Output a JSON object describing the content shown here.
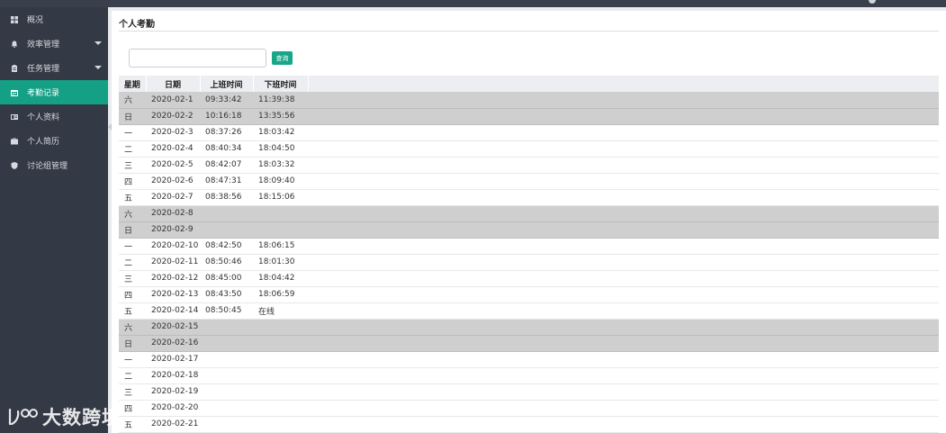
{
  "sidebar": {
    "items": [
      {
        "label": "概况",
        "icon": "dashboard-icon",
        "active": false,
        "has_caret": false
      },
      {
        "label": "效率管理",
        "icon": "bell-icon",
        "active": false,
        "has_caret": true
      },
      {
        "label": "任务管理",
        "icon": "clipboard-icon",
        "active": false,
        "has_caret": true
      },
      {
        "label": "考勤记录",
        "icon": "calendar-icon",
        "active": true,
        "has_caret": false
      },
      {
        "label": "个人资料",
        "icon": "id-card-icon",
        "active": false,
        "has_caret": false
      },
      {
        "label": "个人简历",
        "icon": "briefcase-icon",
        "active": false,
        "has_caret": false
      },
      {
        "label": "讨论组管理",
        "icon": "shield-icon",
        "active": false,
        "has_caret": false
      }
    ]
  },
  "watermark": {
    "text": "大数跨境"
  },
  "panel": {
    "title": "个人考勤"
  },
  "search": {
    "value": "",
    "placeholder": "",
    "button_label": "查询"
  },
  "table": {
    "headers": [
      "星期",
      "日期",
      "上班时间",
      "下班时间"
    ],
    "rows": [
      {
        "day": "六",
        "date": "2020-02-1",
        "in": "09:33:42",
        "out": "11:39:38",
        "weekend": true
      },
      {
        "day": "日",
        "date": "2020-02-2",
        "in": "10:16:18",
        "out": "13:35:56",
        "weekend": true
      },
      {
        "day": "一",
        "date": "2020-02-3",
        "in": "08:37:26",
        "out": "18:03:42",
        "weekend": false
      },
      {
        "day": "二",
        "date": "2020-02-4",
        "in": "08:40:34",
        "out": "18:04:50",
        "weekend": false
      },
      {
        "day": "三",
        "date": "2020-02-5",
        "in": "08:42:07",
        "out": "18:03:32",
        "weekend": false
      },
      {
        "day": "四",
        "date": "2020-02-6",
        "in": "08:47:31",
        "out": "18:09:40",
        "weekend": false
      },
      {
        "day": "五",
        "date": "2020-02-7",
        "in": "08:38:56",
        "out": "18:15:06",
        "weekend": false
      },
      {
        "day": "六",
        "date": "2020-02-8",
        "in": "",
        "out": "",
        "weekend": true
      },
      {
        "day": "日",
        "date": "2020-02-9",
        "in": "",
        "out": "",
        "weekend": true
      },
      {
        "day": "一",
        "date": "2020-02-10",
        "in": "08:42:50",
        "out": "18:06:15",
        "weekend": false
      },
      {
        "day": "二",
        "date": "2020-02-11",
        "in": "08:50:46",
        "out": "18:01:30",
        "weekend": false
      },
      {
        "day": "三",
        "date": "2020-02-12",
        "in": "08:45:00",
        "out": "18:04:42",
        "weekend": false
      },
      {
        "day": "四",
        "date": "2020-02-13",
        "in": "08:43:50",
        "out": "18:06:59",
        "weekend": false
      },
      {
        "day": "五",
        "date": "2020-02-14",
        "in": "08:50:45",
        "out": "在线",
        "weekend": false
      },
      {
        "day": "六",
        "date": "2020-02-15",
        "in": "",
        "out": "",
        "weekend": true
      },
      {
        "day": "日",
        "date": "2020-02-16",
        "in": "",
        "out": "",
        "weekend": true
      },
      {
        "day": "一",
        "date": "2020-02-17",
        "in": "",
        "out": "",
        "weekend": false
      },
      {
        "day": "二",
        "date": "2020-02-18",
        "in": "",
        "out": "",
        "weekend": false
      },
      {
        "day": "三",
        "date": "2020-02-19",
        "in": "",
        "out": "",
        "weekend": false
      },
      {
        "day": "四",
        "date": "2020-02-20",
        "in": "",
        "out": "",
        "weekend": false
      },
      {
        "day": "五",
        "date": "2020-02-21",
        "in": "",
        "out": "",
        "weekend": false
      }
    ]
  },
  "colors": {
    "sidebar_bg": "#333a45",
    "active_item": "#14a085",
    "button": "#18a689",
    "weekend_row": "#cfcfcf",
    "header_row": "#eceef1"
  }
}
